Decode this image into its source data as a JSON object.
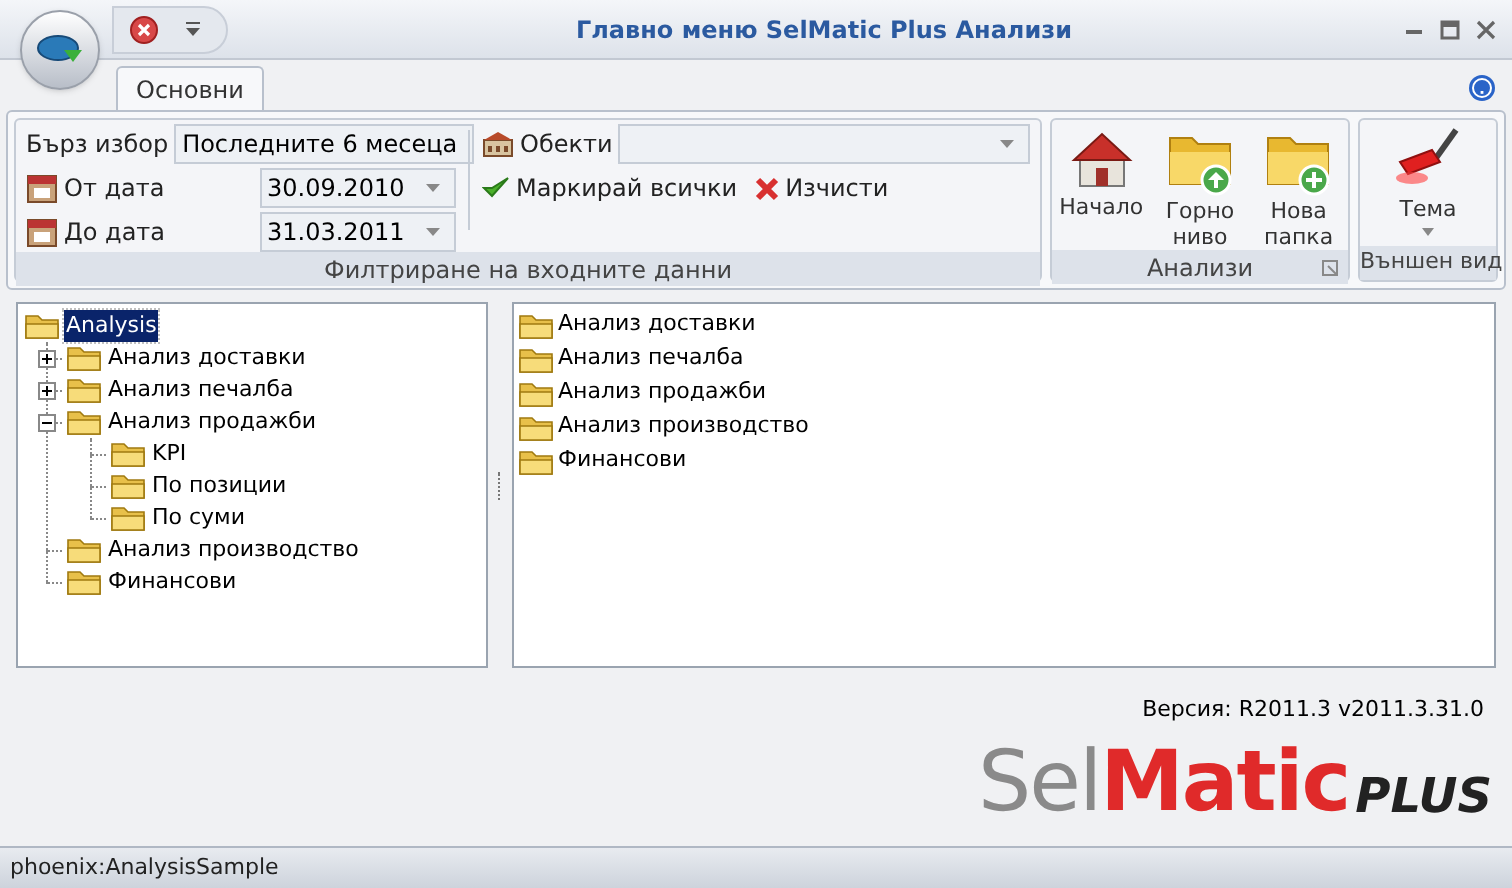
{
  "window": {
    "title": "Главно меню SelMatic Plus Анализи"
  },
  "tabs": [
    {
      "label": "Основни",
      "selected": true
    }
  ],
  "filter_group": {
    "title": "Филтриране на входните данни",
    "quick_pick": {
      "label": "Бърз избор",
      "value": "Последните 6 месеца"
    },
    "from_date": {
      "label": "От дата",
      "value": "30.09.2010"
    },
    "to_date": {
      "label": "До дата",
      "value": "31.03.2011"
    },
    "objects": {
      "label": "Обекти"
    },
    "mark_all": "Маркирай всички",
    "clear": "Изчисти"
  },
  "analyses_group": {
    "title": "Анализи",
    "buttons": [
      {
        "label": "Начало",
        "kind": "home"
      },
      {
        "label": "Горно ниво",
        "kind": "up"
      },
      {
        "label": "Нова папка",
        "kind": "new"
      }
    ]
  },
  "appearance_group": {
    "title": "Външен вид",
    "button": "Тема"
  },
  "tree": [
    {
      "label": "Analysis",
      "selected": true,
      "children": [
        {
          "label": "Анализ доставки",
          "selected": false,
          "expanded": false,
          "has_children": true
        },
        {
          "label": "Анализ печалба",
          "selected": false,
          "expanded": false,
          "has_children": true
        },
        {
          "label": "Анализ продажби",
          "selected": false,
          "expanded": true,
          "has_children": true,
          "children": [
            {
              "label": "KPI",
              "selected": false
            },
            {
              "label": "По позиции",
              "selected": false
            },
            {
              "label": "По суми",
              "selected": false
            }
          ]
        },
        {
          "label": "Анализ производство",
          "selected": false
        },
        {
          "label": "Финансови",
          "selected": false
        }
      ]
    }
  ],
  "folder_list": [
    "Анализ доставки",
    "Анализ печалба",
    "Анализ продажби",
    "Анализ производство",
    "Финансови"
  ],
  "version": "Версия: R2011.3 v2011.3.31.0",
  "logo": {
    "part_1": "Sel",
    "part_2": "Matic",
    "part_3": "PLUS"
  },
  "status_bar": "phoenix:AnalysisSample"
}
